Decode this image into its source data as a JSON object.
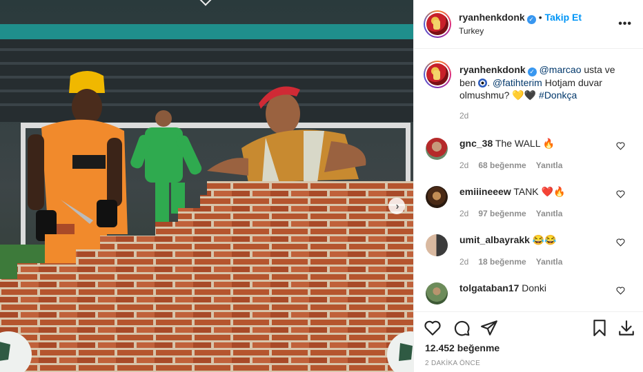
{
  "post": {
    "username": "ryanhenkdonk",
    "follow_label": "Takip Et",
    "location": "Turkey",
    "more_label": "•••",
    "next_arrow": "›"
  },
  "caption": {
    "username": "ryanhenkdonk",
    "mention1": "@marcao",
    "text1": " usta ve ben ",
    "mention2": "@fatihterim",
    "text2": " Hotjam duvar olmushmu? ",
    "emoji": "💛🖤",
    "hashtag": "#Donkça",
    "time": "2d"
  },
  "comments": [
    {
      "username": "gnc_38",
      "text": "The WALL 🔥",
      "time": "2d",
      "likes": "68 beğenme",
      "reply": "Yanıtla"
    },
    {
      "username": "emiiineeew",
      "text": "TANK ❤️🔥",
      "time": "2d",
      "likes": "97 beğenme",
      "reply": "Yanıtla"
    },
    {
      "username": "umit_albayrakk",
      "text": "😂😂",
      "time": "2d",
      "likes": "18 beğenme",
      "reply": "Yanıtla"
    },
    {
      "username": "tolgataban17",
      "text": "Donki",
      "time": "",
      "likes": "",
      "reply": ""
    }
  ],
  "actions": {
    "icons": [
      "heart-icon",
      "comment-icon",
      "share-icon",
      "bookmark-icon",
      "download-icon"
    ],
    "likes": "12.452 beğenme",
    "posted_ago": "2 DAKİKA ÖNCE"
  },
  "colors": {
    "accent": "#0095f6",
    "verified": "#3897f0",
    "brick": "#b5552e",
    "mortar": "#d9c6ad",
    "jersey": "#f18a2c",
    "keeper": "#2faa4f"
  }
}
